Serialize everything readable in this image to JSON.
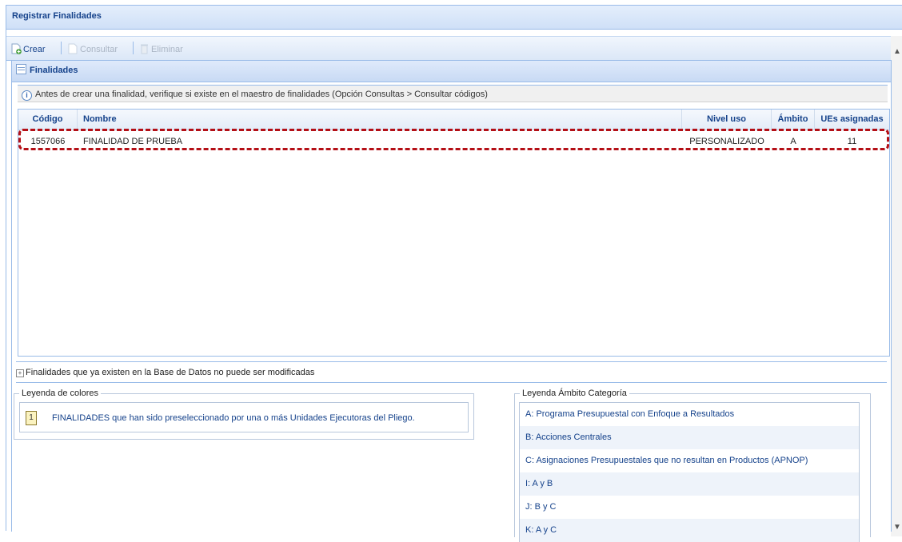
{
  "window": {
    "title": "Registrar Finalidades"
  },
  "toolbar": {
    "crear": "Crear",
    "consultar": "Consultar",
    "eliminar": "Eliminar"
  },
  "panel": {
    "title": "Finalidades",
    "info": "Antes de crear una finalidad, verifique si existe en el maestro de finalidades (Opción Consultas > Consultar códigos)"
  },
  "grid": {
    "headers": {
      "codigo": "Código",
      "nombre": "Nombre",
      "nivel": "Nivel uso",
      "ambito": "Ámbito",
      "ues": "UEs asignadas"
    },
    "rows": [
      {
        "codigo": "1557066",
        "nombre": "FINALIDAD DE PRUEBA",
        "nivel": "PERSONALIZADO",
        "ambito": "A",
        "ues": "11"
      }
    ]
  },
  "existing": {
    "label": "Finalidades que ya existen en la Base de Datos no puede ser modificadas"
  },
  "legend_colores": {
    "title": "Leyenda de colores",
    "swatch": "1",
    "text": "FINALIDADES que han sido preseleccionado por una o más Unidades Ejecutoras del Pliego."
  },
  "legend_ambito": {
    "title": "Leyenda Ámbito Categoría",
    "items": [
      "A: Programa Presupuestal con Enfoque a Resultados",
      "B: Acciones Centrales",
      "C: Asignaciones Presupuestales que no resultan en Productos (APNOP)",
      "I: A y B",
      "J: B y C",
      "K: A y C"
    ]
  },
  "colors": {
    "accent": "#15428b",
    "border": "#99bbe8",
    "highlight": "#b40f16",
    "swatch": "#fbf3c0"
  }
}
